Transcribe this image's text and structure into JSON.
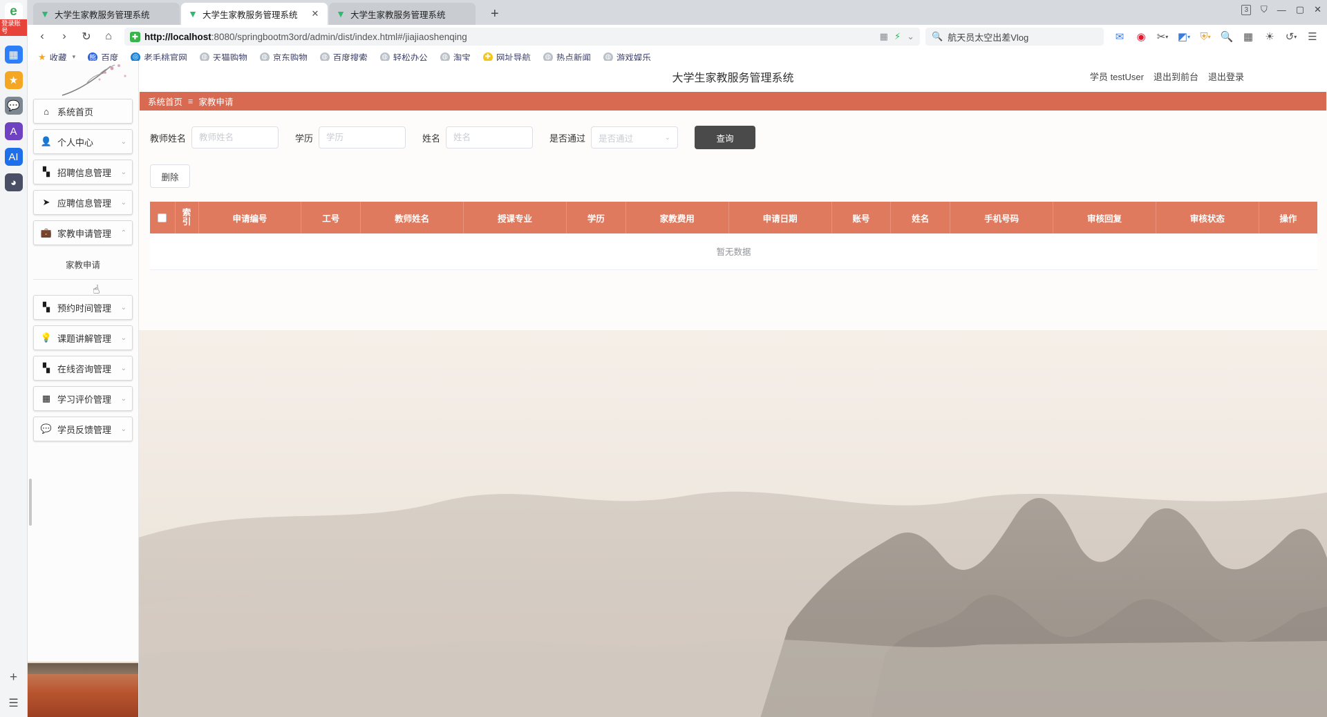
{
  "browser": {
    "tabs": [
      {
        "title": "大学生家教服务管理系统",
        "active": false,
        "closable": false
      },
      {
        "title": "大学生家教服务管理系统",
        "active": true,
        "closable": true
      },
      {
        "title": "大学生家教服务管理系统",
        "active": false,
        "closable": false
      }
    ],
    "new_tab_label": "+",
    "window_controls": {
      "tab_count": "3",
      "minimize": "—",
      "maximize": "▢",
      "close": "✕",
      "collections": "⛉"
    },
    "nav": {
      "back": "‹",
      "forward": "›",
      "reload": "↻",
      "home": "⌂"
    },
    "url": {
      "scheme_host": "http://localhost",
      "rest": ":8080/springbootm3ord/admin/dist/index.html#/jiajiaoshenqing",
      "full": "http://localhost:8080/springbootm3ord/admin/dist/index.html#/jiajiaoshenqing",
      "shield": "✚"
    },
    "search": {
      "value": "航天员太空出差Vlog",
      "icon": "search-icon"
    },
    "toolbar_icons": [
      "mail-icon",
      "weibo-icon",
      "scissors-icon",
      "palette-icon",
      "shield-extension-icon",
      "magnifier-icon",
      "grid-apps-icon",
      "brightness-icon",
      "history-icon",
      "menu-icon"
    ],
    "bookmarks": [
      {
        "label": "收藏",
        "icon": "star-icon",
        "caret": "▾"
      },
      {
        "label": "百度",
        "icon": "baidu-icon"
      },
      {
        "label": "老毛桃官网",
        "icon": "laomaotao-icon"
      },
      {
        "label": "天猫购物",
        "icon": "globe-icon"
      },
      {
        "label": "京东购物",
        "icon": "globe-icon"
      },
      {
        "label": "百度搜索",
        "icon": "globe-icon"
      },
      {
        "label": "轻松办公",
        "icon": "globe-icon"
      },
      {
        "label": "淘宝",
        "icon": "globe-icon"
      },
      {
        "label": "网址导航",
        "icon": "navigation-icon"
      },
      {
        "label": "热点新闻",
        "icon": "globe-icon"
      },
      {
        "label": "游戏娱乐",
        "icon": "globe-icon"
      }
    ],
    "left_rail": {
      "logo": "e",
      "login_label": "登录账号",
      "icons": [
        "grid-icon",
        "star-icon",
        "chat-icon",
        "ai-icon",
        "ai2-icon",
        "avatar-icon"
      ],
      "bottom_icons": [
        "plus-icon",
        "list-icon"
      ]
    }
  },
  "site": {
    "title": "大学生家教服务管理系统",
    "user": {
      "role_label": "学员",
      "name": "testUser"
    },
    "actions": [
      {
        "label": "退出到前台"
      },
      {
        "label": "退出登录"
      }
    ],
    "breadcrumb": {
      "home": "系统首页",
      "separator": "≡",
      "current": "家教申请"
    },
    "sidebar": [
      {
        "label": "系统首页",
        "icon": "home-icon",
        "arrow": "",
        "expanded": false
      },
      {
        "label": "个人中心",
        "icon": "user-icon",
        "arrow": "⌄",
        "expanded": false
      },
      {
        "label": "招聘信息管理",
        "icon": "grid-icon",
        "arrow": "⌄",
        "expanded": false
      },
      {
        "label": "应聘信息管理",
        "icon": "send-icon",
        "arrow": "⌄",
        "expanded": false
      },
      {
        "label": "家教申请管理",
        "icon": "briefcase-icon",
        "arrow": "⌃",
        "expanded": true,
        "children": [
          "家教申请"
        ]
      },
      {
        "label": "预约时间管理",
        "icon": "grid-icon",
        "arrow": "⌄",
        "expanded": false
      },
      {
        "label": "课题讲解管理",
        "icon": "bulb-icon",
        "arrow": "⌄",
        "expanded": false
      },
      {
        "label": "在线咨询管理",
        "icon": "grid-icon",
        "arrow": "⌄",
        "expanded": false
      },
      {
        "label": "学习评价管理",
        "icon": "table-icon",
        "arrow": "⌄",
        "expanded": false
      },
      {
        "label": "学员反馈管理",
        "icon": "feedback-icon",
        "arrow": "⌄",
        "expanded": false
      }
    ],
    "filters": [
      {
        "name": "teacher_name",
        "label": "教师姓名",
        "placeholder": "教师姓名",
        "value": "",
        "type": "text"
      },
      {
        "name": "education",
        "label": "学历",
        "placeholder": "学历",
        "value": "",
        "type": "text"
      },
      {
        "name": "student_name",
        "label": "姓名",
        "placeholder": "姓名",
        "value": "",
        "type": "text"
      },
      {
        "name": "approved",
        "label": "是否通过",
        "placeholder": "是否通过",
        "value": "",
        "type": "select"
      }
    ],
    "search_button": "查询",
    "delete_button": "删除",
    "table": {
      "columns": [
        "索引",
        "申请编号",
        "工号",
        "教师姓名",
        "授课专业",
        "学历",
        "家教费用",
        "申请日期",
        "账号",
        "姓名",
        "手机号码",
        "审核回复",
        "审核状态",
        "操作"
      ],
      "index_header_lines": [
        "索",
        "引"
      ],
      "rows": [],
      "empty_text": "暂无数据"
    },
    "colors": {
      "accent": "#e07a5f",
      "breadcrumb_bar": "#d96a52",
      "button_dark": "#4a4a4a",
      "empty_text": "#909399"
    }
  }
}
